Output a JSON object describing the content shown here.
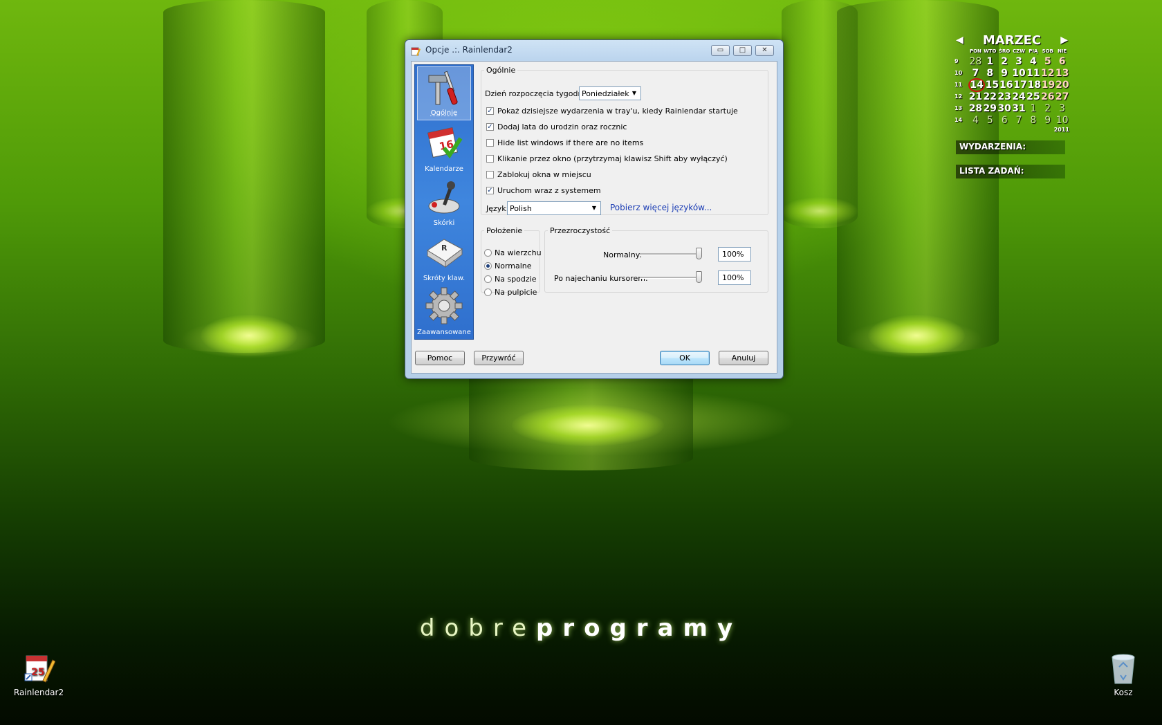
{
  "desktop": {
    "brand_light": "dobre",
    "brand_bold": "programy",
    "icons": [
      {
        "label": "Rainlendar2",
        "icon": "rainlendar-icon"
      },
      {
        "label": "Kosz",
        "icon": "recycle-bin-icon"
      }
    ]
  },
  "calendar": {
    "month": "MARZEC",
    "year": "2011",
    "weekdays": [
      "PON",
      "WTO",
      "ŚRO",
      "CZW",
      "PIĄ",
      "SOB",
      "NIE"
    ],
    "weeks": [
      {
        "num": "9",
        "days": [
          "28",
          "1",
          "2",
          "3",
          "4",
          "5",
          "6"
        ]
      },
      {
        "num": "10",
        "days": [
          "7",
          "8",
          "9",
          "10",
          "11",
          "12",
          "13"
        ]
      },
      {
        "num": "11",
        "days": [
          "14",
          "15",
          "16",
          "17",
          "18",
          "19",
          "20"
        ]
      },
      {
        "num": "12",
        "days": [
          "21",
          "22",
          "23",
          "24",
          "25",
          "26",
          "27"
        ]
      },
      {
        "num": "13",
        "days": [
          "28",
          "29",
          "30",
          "31",
          "1",
          "2",
          "3"
        ]
      },
      {
        "num": "14",
        "days": [
          "4",
          "5",
          "6",
          "7",
          "8",
          "9",
          "10"
        ]
      }
    ],
    "today": "14",
    "events_label": "WYDARZENIA:",
    "tasks_label": "LISTA ZADAŃ:"
  },
  "dialog": {
    "title": "Opcje .:. Rainlendar2",
    "window_buttons": {
      "minimize": "▭",
      "maximize": "□",
      "close": "✕"
    },
    "nav": [
      {
        "label": "Ogólnie",
        "icon": "tools-icon",
        "selected": true
      },
      {
        "label": "Kalendarze",
        "icon": "calendar-icon",
        "selected": false
      },
      {
        "label": "Skórki",
        "icon": "joystick-icon",
        "selected": false
      },
      {
        "label": "Skróty klaw.",
        "icon": "keyboard-key-icon",
        "selected": false
      },
      {
        "label": "Zaawansowane",
        "icon": "gear-icon",
        "selected": false
      }
    ],
    "general": {
      "legend": "Ogólnie",
      "week_start_label": "Dzień rozpoczęcia tygodnia:",
      "week_start_value": "Poniedziałek",
      "options": [
        {
          "label": "Pokaż dzisiejsze wydarzenia w tray'u, kiedy Rainlendar startuje",
          "checked": true
        },
        {
          "label": "Dodaj lata do urodzin oraz rocznic",
          "checked": true
        },
        {
          "label": "Hide list windows if there are no items",
          "checked": false
        },
        {
          "label": "Klikanie przez okno (przytrzymaj klawisz Shift aby wyłączyć)",
          "checked": false
        },
        {
          "label": "Zablokuj okna w miejscu",
          "checked": false
        },
        {
          "label": "Uruchom wraz z systemem",
          "checked": true
        }
      ],
      "language_label": "Język:",
      "language_value": "Polish",
      "more_languages_link": "Pobierz więcej języków..."
    },
    "position": {
      "legend": "Położenie",
      "options": [
        {
          "label": "Na wierzchu",
          "selected": false
        },
        {
          "label": "Normalne",
          "selected": true
        },
        {
          "label": "Na spodzie",
          "selected": false
        },
        {
          "label": "Na pulpicie",
          "selected": false
        }
      ]
    },
    "transparency": {
      "legend": "Przezroczystość",
      "normal_label": "Normalny:",
      "normal_value": "100%",
      "hover_label": "Po najechaniu kursorem:",
      "hover_value": "100%",
      "normal_level": 1.0,
      "hover_level": 1.0
    },
    "buttons": {
      "help": "Pomoc",
      "restore": "Przywróć",
      "ok": "OK",
      "cancel": "Anuluj"
    }
  }
}
